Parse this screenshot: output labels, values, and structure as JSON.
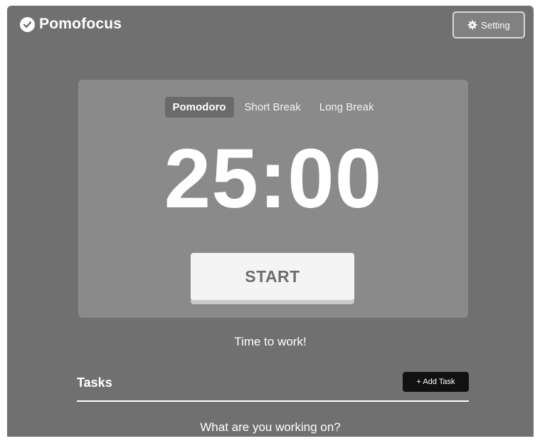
{
  "header": {
    "brand": "Pomofocus",
    "setting_label": "Setting"
  },
  "modes": {
    "pomodoro": "Pomodoro",
    "short_break": "Short Break",
    "long_break": "Long Break",
    "active": "Pomodoro"
  },
  "timer": {
    "display": "25:00",
    "start_label": "START"
  },
  "status_text": "Time to work!",
  "tasks": {
    "title": "Tasks",
    "add_label": "+ Add Task",
    "prompt": "What are you working on?"
  },
  "colors": {
    "background": "#707070",
    "card": "#8a8a8a",
    "active_tab": "#6a6a6a",
    "button": "#f4f4f4",
    "add_task_button": "#111111"
  },
  "icons": {
    "brand": "check-circle-icon",
    "setting": "gear-icon"
  }
}
